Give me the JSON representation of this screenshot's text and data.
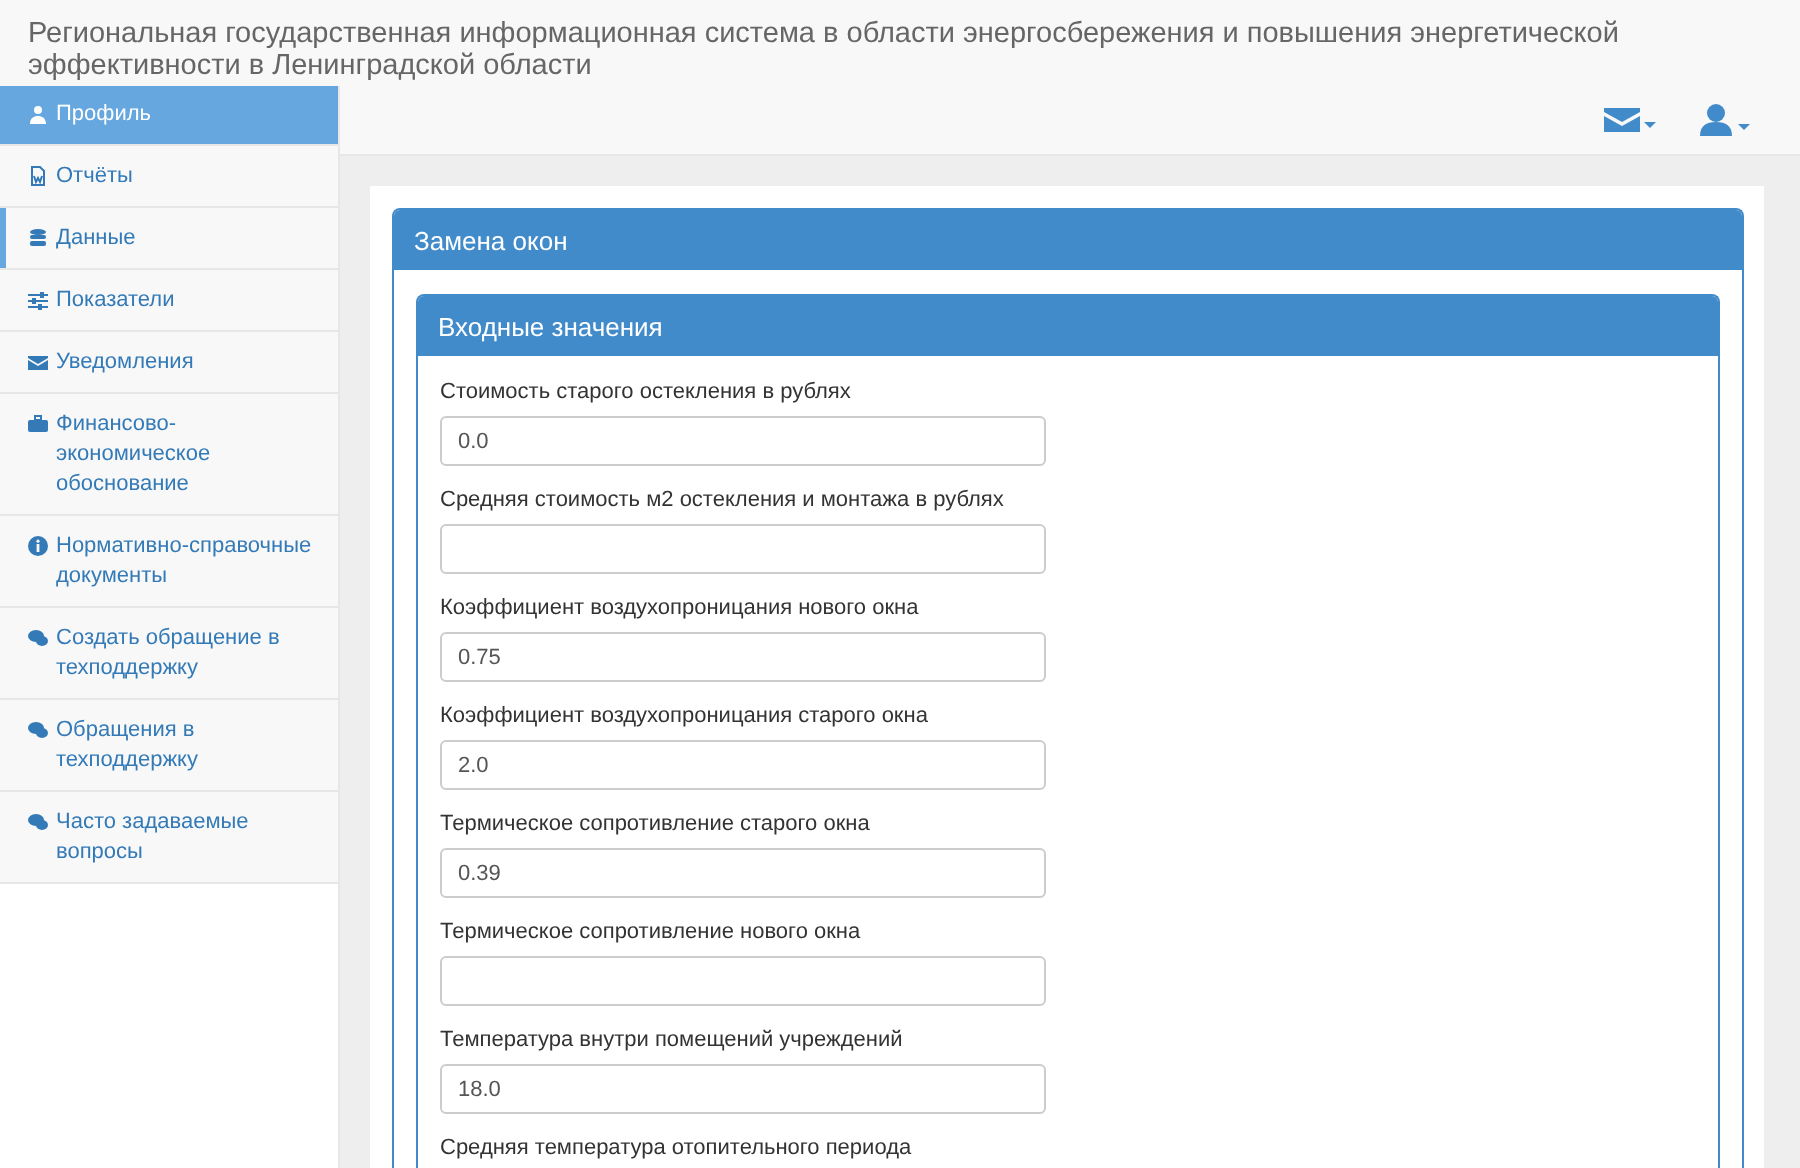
{
  "header": {
    "title": "Региональная государственная информационная система в области энергосбережения и повышения энергетической эффективности в Ленинградской области"
  },
  "sidebar": {
    "items": [
      {
        "label": "Профиль",
        "selected": true,
        "current": false
      },
      {
        "label": "Отчёты",
        "selected": false,
        "current": false
      },
      {
        "label": "Данные",
        "selected": false,
        "current": true
      },
      {
        "label": "Показатели",
        "selected": false,
        "current": false
      },
      {
        "label": "Уведомления",
        "selected": false,
        "current": false
      },
      {
        "label": "Финансово-экономическое обоснование",
        "selected": false,
        "current": false
      },
      {
        "label": "Нормативно-справочные документы",
        "selected": false,
        "current": false
      },
      {
        "label": "Создать обращение в техподдержку",
        "selected": false,
        "current": false
      },
      {
        "label": "Обращения в техподдержку",
        "selected": false,
        "current": false
      },
      {
        "label": "Часто задаваемые вопросы",
        "selected": false,
        "current": false
      }
    ]
  },
  "panel": {
    "title": "Замена окон",
    "inner": {
      "title": "Входные значения",
      "fields": [
        {
          "label": "Стоимость старого остекления в рублях",
          "value": "0.0"
        },
        {
          "label": "Средняя стоимость м2 остекления и монтажа в рублях"
        },
        {
          "label": "Коэффициент воздухопроницания нового окна",
          "value": "0.75"
        },
        {
          "label": "Коэффициент воздухопроницания старого окна",
          "value": "2.0"
        },
        {
          "label": "Термическое сопротивление старого окна",
          "value": "0.39"
        },
        {
          "label": "Термическое сопротивление нового окна"
        },
        {
          "label": "Температура внутри помещений учреждений",
          "value": "18.0"
        },
        {
          "label": "Средняя температура отопительного периода"
        }
      ]
    }
  }
}
